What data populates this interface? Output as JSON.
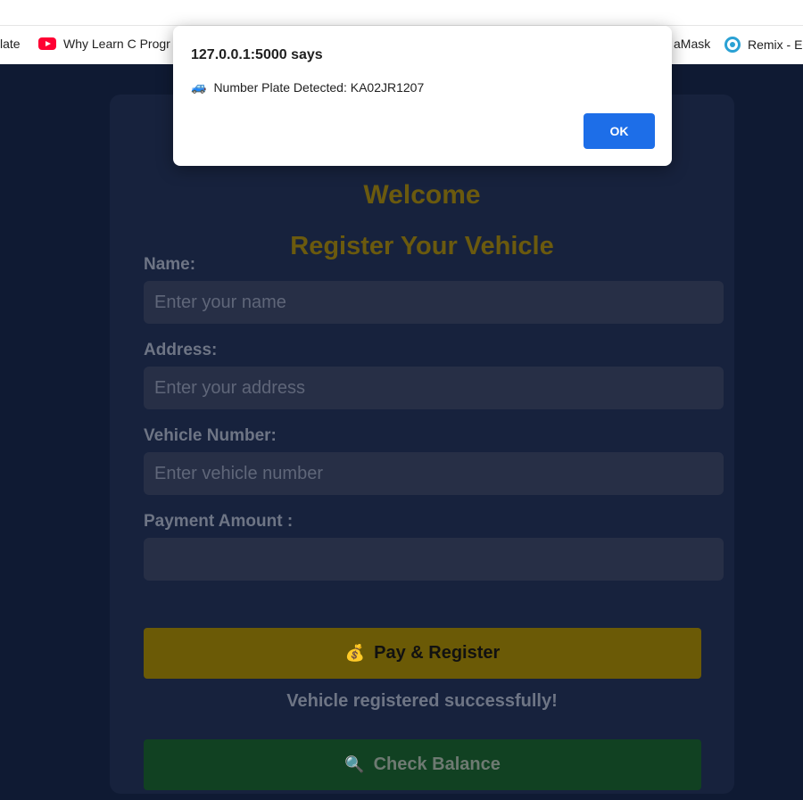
{
  "bookmarks": {
    "items": [
      {
        "label": "late",
        "icon": "none"
      },
      {
        "label": "Why Learn C Progr",
        "icon": "youtube-icon"
      },
      {
        "label": "aMask",
        "icon": "none"
      },
      {
        "label": "Remix - E",
        "icon": "remix-icon"
      }
    ]
  },
  "dialog": {
    "title": "127.0.0.1:5000 says",
    "message_icon": "🚙",
    "message": "Number Plate Detected: KA02JR1207",
    "ok_label": "OK"
  },
  "form": {
    "welcome": "Welcome",
    "heading": "Register Your Vehicle",
    "name_label": "Name:",
    "name_placeholder": "Enter your name",
    "address_label": "Address:",
    "address_placeholder": "Enter your address",
    "vehicle_label": "Vehicle Number:",
    "vehicle_placeholder": "Enter vehicle number",
    "payment_label": "Payment Amount :",
    "payment_value": "",
    "pay_button_icon": "💰",
    "pay_button_label": "Pay & Register",
    "status_text": "Vehicle registered successfully!",
    "check_button_icon": "🔍",
    "check_button_label": "Check Balance"
  },
  "colors": {
    "page_bg": "#0f1a33",
    "card_bg": "#17223d",
    "accent_gold": "#6b5a06",
    "accent_green": "#114122",
    "dialog_button": "#1d6ee8"
  }
}
